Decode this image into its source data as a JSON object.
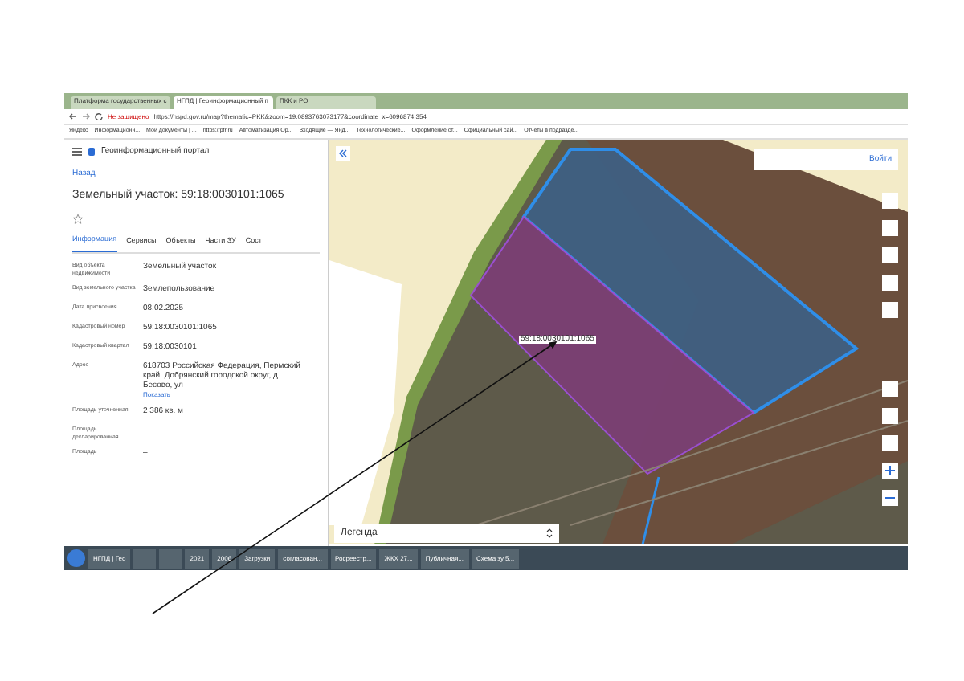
{
  "browser": {
    "tabs": [
      {
        "label": "Платформа государственных с",
        "selected": false
      },
      {
        "label": "НГПД | Геоинформационный п",
        "selected": true
      },
      {
        "label": "ПКК и РО",
        "selected": false
      }
    ],
    "security": "Не защищено",
    "address": "https://nspd.gov.ru/map?thematic=PKK&zoom=19.0893763073177&coordinate_x=6096874.354",
    "bookmarks": [
      "Яндекс",
      "Информационн...",
      "Мои документы | ...",
      "https://pfr.ru",
      "Автоматизация Ор...",
      "Входящие — Янд...",
      "Технологические...",
      "Оформление ст...",
      "Официальный сай...",
      "Отчеты в подразде..."
    ]
  },
  "portal": {
    "title": "Геоинформационный портал",
    "back": "Назад",
    "heading": "Земельный участок: 59:18:0030101:1065",
    "starred": false,
    "tabs": [
      {
        "label": "Информация",
        "selected": true
      },
      {
        "label": "Сервисы",
        "selected": false
      },
      {
        "label": "Объекты",
        "selected": false
      },
      {
        "label": "Части ЗУ",
        "selected": false
      },
      {
        "label": "Сост",
        "selected": false
      }
    ],
    "fields": [
      {
        "label": "Вид объекта недвижимости",
        "value": "Земельный участок"
      },
      {
        "label": "Вид земельного участка",
        "value": "Землепользование"
      },
      {
        "label": "Дата присвоения",
        "value": "08.02.2025"
      },
      {
        "label": "Кадастровый номер",
        "value": "59:18:0030101:1065"
      },
      {
        "label": "Кадастровый квартал",
        "value": "59:18:0030101"
      },
      {
        "label": "Адрес",
        "value": "618703 Российская Федерация, Пермский край, Добрянский городской округ, д. Бесово, ул",
        "link": "Показать"
      },
      {
        "label": "Площадь уточненная",
        "value": "2 386 кв. м"
      },
      {
        "label": "Площадь декларированная",
        "value": "–"
      },
      {
        "label": "Площадь",
        "value": "–"
      }
    ]
  },
  "map": {
    "login": "Войти",
    "parcel_label": "59:18:0030101:1065",
    "legend": "Легенда"
  },
  "taskbar": {
    "items": [
      {
        "kind": "button",
        "label": "НГПД | Гео"
      },
      {
        "kind": "icon"
      },
      {
        "kind": "icon"
      },
      {
        "kind": "button",
        "label": "2021"
      },
      {
        "kind": "button",
        "label": "2006"
      },
      {
        "kind": "button",
        "label": "Загрузки"
      },
      {
        "kind": "button",
        "label": "согласован..."
      },
      {
        "kind": "button",
        "label": "Росреестр..."
      },
      {
        "kind": "button",
        "label": "ЖКХ 27..."
      },
      {
        "kind": "button",
        "label": "Публичная..."
      },
      {
        "kind": "button",
        "label": "Схема зу 5..."
      }
    ]
  }
}
